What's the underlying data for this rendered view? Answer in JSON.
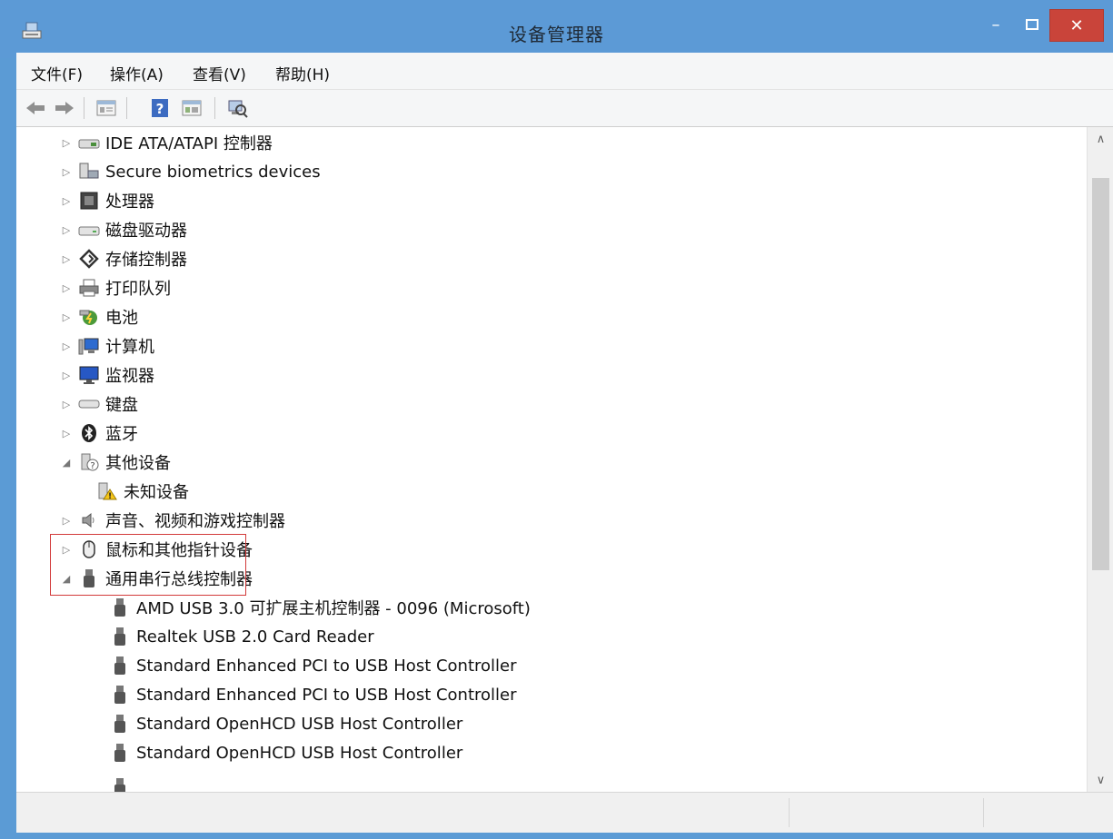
{
  "window": {
    "title": "设备管理器"
  },
  "menu": {
    "items": [
      "文件(F)",
      "操作(A)",
      "查看(V)",
      "帮助(H)"
    ]
  },
  "toolbar": {
    "tools": [
      "back-arrow-icon",
      "forward-arrow-icon",
      "properties-icon",
      "help-icon",
      "view-icon",
      "scan-hardware-icon"
    ]
  },
  "tree": {
    "categories": [
      {
        "label": "IDE ATA/ATAPI 控制器",
        "icon": "ide-controller-icon",
        "expanded": false
      },
      {
        "label": "Secure biometrics devices",
        "icon": "biometric-icon",
        "expanded": false
      },
      {
        "label": "处理器",
        "icon": "processor-icon",
        "expanded": false
      },
      {
        "label": "磁盘驱动器",
        "icon": "disk-drive-icon",
        "expanded": false
      },
      {
        "label": "存储控制器",
        "icon": "storage-controller-icon",
        "expanded": false
      },
      {
        "label": "打印队列",
        "icon": "printer-icon",
        "expanded": false
      },
      {
        "label": "电池",
        "icon": "battery-icon",
        "expanded": false
      },
      {
        "label": "计算机",
        "icon": "computer-icon",
        "expanded": false
      },
      {
        "label": "监视器",
        "icon": "monitor-icon",
        "expanded": false
      },
      {
        "label": "键盘",
        "icon": "keyboard-icon",
        "expanded": false
      },
      {
        "label": "蓝牙",
        "icon": "bluetooth-icon",
        "expanded": false
      },
      {
        "label": "其他设备",
        "icon": "unknown-device-icon",
        "expanded": true
      },
      {
        "label": "未知设备",
        "icon": "warning-device-icon",
        "child": true
      },
      {
        "label": "声音、视频和游戏控制器",
        "icon": "speaker-icon",
        "expanded": false
      },
      {
        "label": "鼠标和其他指针设备",
        "icon": "mouse-icon",
        "expanded": false
      },
      {
        "label": "通用串行总线控制器",
        "icon": "usb-icon",
        "expanded": true
      },
      {
        "label": "AMD USB 3.0 可扩展主机控制器 - 0096 (Microsoft)",
        "icon": "usb-icon",
        "child": true
      },
      {
        "label": "Realtek USB 2.0 Card Reader",
        "icon": "usb-icon",
        "child": true
      },
      {
        "label": "Standard Enhanced PCI to USB Host Controller",
        "icon": "usb-icon",
        "child": true
      },
      {
        "label": "Standard Enhanced PCI to USB Host Controller",
        "icon": "usb-icon",
        "child": true
      },
      {
        "label": "Standard OpenHCD USB Host Controller",
        "icon": "usb-icon",
        "child": true
      },
      {
        "label": "Standard OpenHCD USB Host Controller",
        "icon": "usb-icon",
        "child": true
      }
    ]
  },
  "colors": {
    "titlebar": "#5c9ad6",
    "close": "#c9443a",
    "highlight": "#d23a3a"
  }
}
